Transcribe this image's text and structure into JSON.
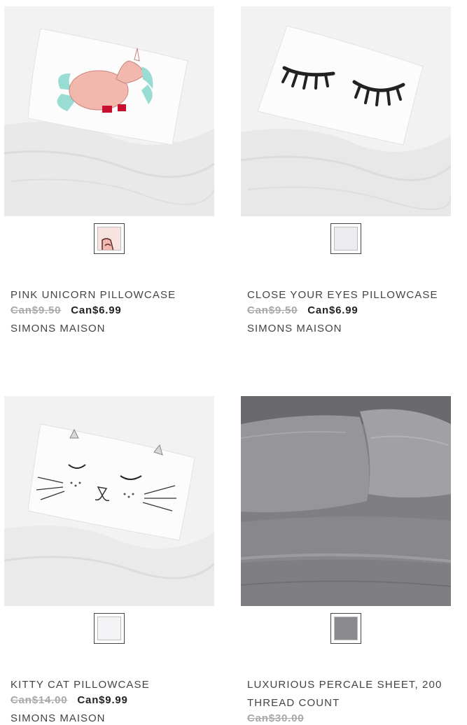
{
  "products": [
    {
      "name": "PINK UNICORN PILLOWCASE",
      "old_price": "Can$9.50",
      "price": "Can$6.99",
      "brand": "SIMONS MAISON",
      "swatch_color": "#f2b8ae",
      "image": "unicorn-pillow-image"
    },
    {
      "name": "CLOSE YOUR EYES PILLOWCASE",
      "old_price": "Can$9.50",
      "price": "Can$6.99",
      "brand": "SIMONS MAISON",
      "swatch_color": "#ececf0",
      "image": "sleeping-eyes-pillow-image"
    },
    {
      "name": "KITTY CAT PILLOWCASE",
      "old_price": "Can$14.00",
      "price": "Can$9.99",
      "brand": "SIMONS MAISON",
      "swatch_color": "#f4f4f6",
      "image": "kitty-cat-pillow-image"
    },
    {
      "name": "LUXURIOUS PERCALE SHEET, 200 THREAD COUNT",
      "old_price": "Can$30.00",
      "price": "",
      "brand": "",
      "swatch_color": "#8a8a8e",
      "image": "grey-sheet-image"
    }
  ]
}
